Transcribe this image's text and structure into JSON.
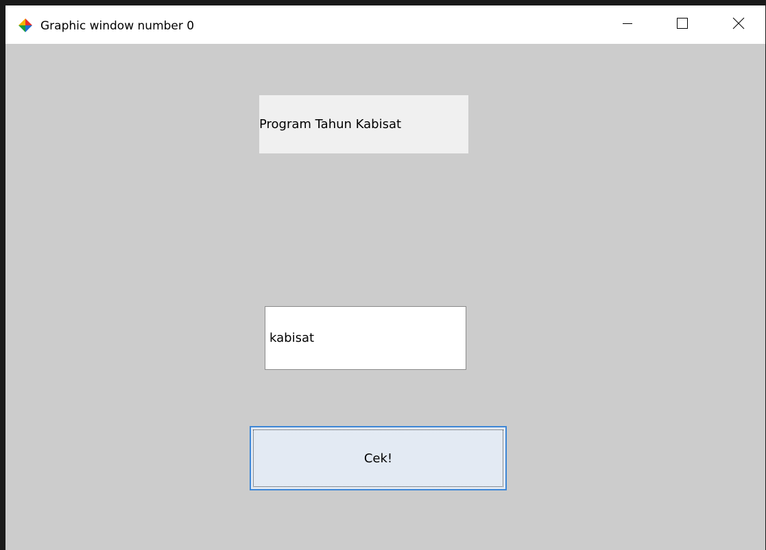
{
  "window": {
    "title": "Graphic window number 0"
  },
  "titlebar_buttons": {
    "minimize": "minimize-icon",
    "maximize": "maximize-icon",
    "close": "close-icon"
  },
  "label": {
    "text": "Program Tahun Kabisat"
  },
  "edit": {
    "value": "kabisat"
  },
  "button": {
    "label": "Cek!"
  },
  "colors": {
    "client_background": "#cccccc",
    "label_background": "#f0f0f0",
    "button_background": "#e3eaf3",
    "button_border": "#3d86d6"
  }
}
